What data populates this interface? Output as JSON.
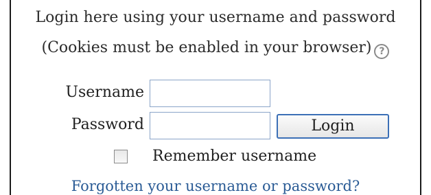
{
  "login": {
    "heading_line1": "Login here using your username and password",
    "heading_line2": "(Cookies must be enabled in your browser)",
    "help_icon": "help-question-icon",
    "username_label": "Username",
    "username_value": "",
    "password_label": "Password",
    "password_value": "",
    "login_button": "Login",
    "remember_checked": false,
    "remember_label": "Remember username",
    "forgot_link": "Forgotten your username or password?"
  },
  "colors": {
    "link": "#2a5b95",
    "button_border": "#3b6fb6",
    "input_border": "#8aa4c8",
    "panel_border": "#1a1a1a"
  }
}
